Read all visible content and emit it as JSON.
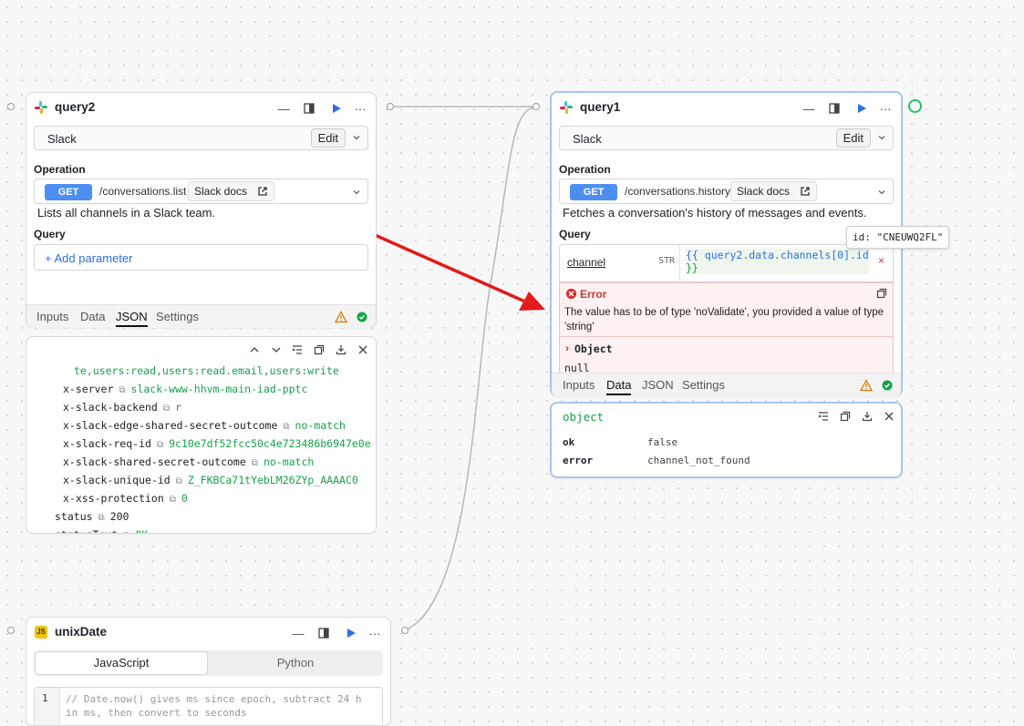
{
  "colors": {
    "accent": "#4d8ef3",
    "error": "#d13438",
    "success": "#16a34a",
    "selected_border": "#a9c4f5"
  },
  "query2": {
    "title": "query2",
    "resource": "Slack",
    "edit_label": "Edit",
    "operation_label": "Operation",
    "method": "GET",
    "path": "/conversations.list",
    "docs_label": "Slack docs",
    "description": "Lists all channels in a Slack team.",
    "query_label": "Query",
    "add_param": "+ Add parameter",
    "tabs": [
      "Inputs",
      "Data",
      "JSON",
      "Settings"
    ],
    "active_tab": "JSON"
  },
  "json_view": {
    "lines": [
      {
        "key": "",
        "value": "te,users:read,users:read.email,users:write"
      },
      {
        "key": "x-server",
        "value": "slack-www-hhvm-main-iad-pptc"
      },
      {
        "key": "x-slack-backend",
        "value": "r"
      },
      {
        "key": "x-slack-edge-shared-secret-outcome",
        "value": "no-match"
      },
      {
        "key": "x-slack-req-id",
        "value": "9c10e7df52fcc50c4e723486b6947e0e"
      },
      {
        "key": "x-slack-shared-secret-outcome",
        "value": "no-match"
      },
      {
        "key": "x-slack-unique-id",
        "value": "Z_FKBCa71tYebLM26ZYp_AAAAC0"
      },
      {
        "key": "x-xss-protection",
        "value": "0"
      },
      {
        "key": "status",
        "value": "200"
      },
      {
        "key": "statusText",
        "value": "OK"
      }
    ]
  },
  "query1": {
    "title": "query1",
    "resource": "Slack",
    "edit_label": "Edit",
    "operation_label": "Operation",
    "method": "GET",
    "path": "/conversations.history",
    "docs_label": "Slack docs",
    "description": "Fetches a conversation's history of messages and events.",
    "query_label": "Query",
    "param_name": "channel",
    "param_type": "STR",
    "param_value_l1": "{{ query2.data.channels[0].id",
    "param_value_l2": "}}",
    "tooltip": "id: \"CNEUWQ2FL\"",
    "error_title": "Error",
    "error_message": "The value has to be of type 'noValidate', you provided a value of type 'string'",
    "error_object": "Object",
    "error_null": "null",
    "tabs": [
      "Inputs",
      "Data",
      "JSON",
      "Settings"
    ],
    "active_tab": "Data"
  },
  "result": {
    "title": "object",
    "rows": [
      {
        "key": "ok",
        "value": "false"
      },
      {
        "key": "error",
        "value": "channel_not_found"
      }
    ]
  },
  "unixDate": {
    "title": "unixDate",
    "lang_tabs": [
      "JavaScript",
      "Python"
    ],
    "line_number": "1",
    "code_l1": "// Date.now() gives ms since epoch, subtract 24 h",
    "code_l2": "in ms, then convert to seconds"
  }
}
